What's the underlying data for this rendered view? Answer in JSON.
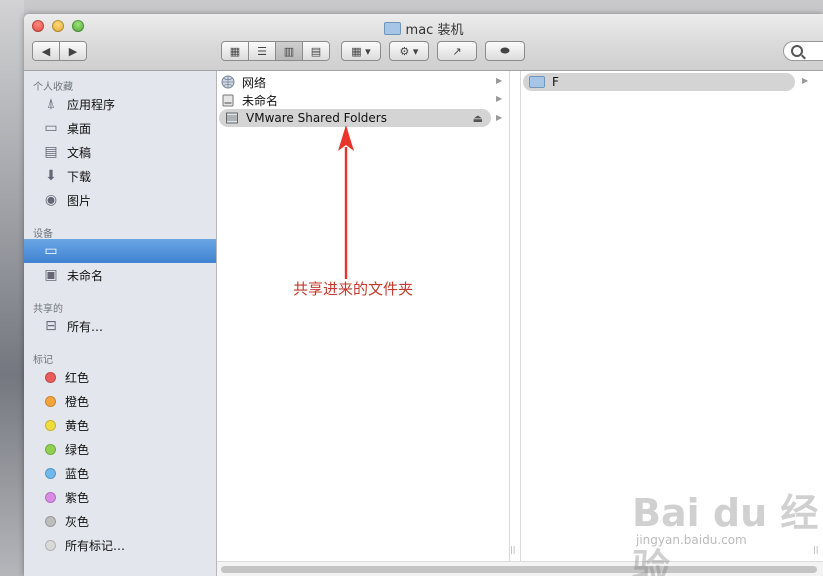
{
  "window": {
    "title": "mac 装机"
  },
  "toolbar": {
    "back": "◀",
    "forward": "▶",
    "views": [
      "▦",
      "☰",
      "▥",
      "▤"
    ],
    "arrange": "▦ ▾",
    "action": "⚙ ▾",
    "share": "↗",
    "tags": "⬬"
  },
  "sidebar": {
    "favorites_header": "个人收藏",
    "favorites": [
      {
        "label": "应用程序",
        "icon": "applications-icon"
      },
      {
        "label": "桌面",
        "icon": "desktop-icon"
      },
      {
        "label": "文稿",
        "icon": "documents-icon"
      },
      {
        "label": "下载",
        "icon": "downloads-icon"
      },
      {
        "label": "图片",
        "icon": "pictures-icon"
      }
    ],
    "devices_header": "设备",
    "devices": [
      {
        "label": "",
        "icon": "computer-icon",
        "selected": true
      },
      {
        "label": "未命名",
        "icon": "disk-icon"
      }
    ],
    "shared_header": "共享的",
    "shared": [
      {
        "label": "所有…",
        "icon": "network-computer-icon"
      }
    ],
    "tags_header": "标记",
    "tags": [
      {
        "label": "红色",
        "color": "#ec5b5b"
      },
      {
        "label": "橙色",
        "color": "#f5a43b"
      },
      {
        "label": "黄色",
        "color": "#f1dc3c"
      },
      {
        "label": "绿色",
        "color": "#8fd14f"
      },
      {
        "label": "蓝色",
        "color": "#6fb7ef"
      },
      {
        "label": "紫色",
        "color": "#d98be6"
      },
      {
        "label": "灰色",
        "color": "#bdbdbd"
      },
      {
        "label": "所有标记…",
        "color": "#d9d9d9"
      }
    ]
  },
  "column1": {
    "items": [
      {
        "label": "网络",
        "icon": "network-icon"
      },
      {
        "label": "未命名",
        "icon": "disk-icon"
      },
      {
        "label": "VMware Shared Folders",
        "icon": "shared-drive-icon",
        "selected": true
      }
    ],
    "eject": "⏏"
  },
  "column3": {
    "items": [
      {
        "label": "F",
        "icon": "folder-icon"
      }
    ]
  },
  "annotation": {
    "text": "共享进来的文件夹",
    "color": "#e8352b"
  },
  "watermark": {
    "brand": "Bai du 经验",
    "url": "jingyan.baidu.com"
  }
}
